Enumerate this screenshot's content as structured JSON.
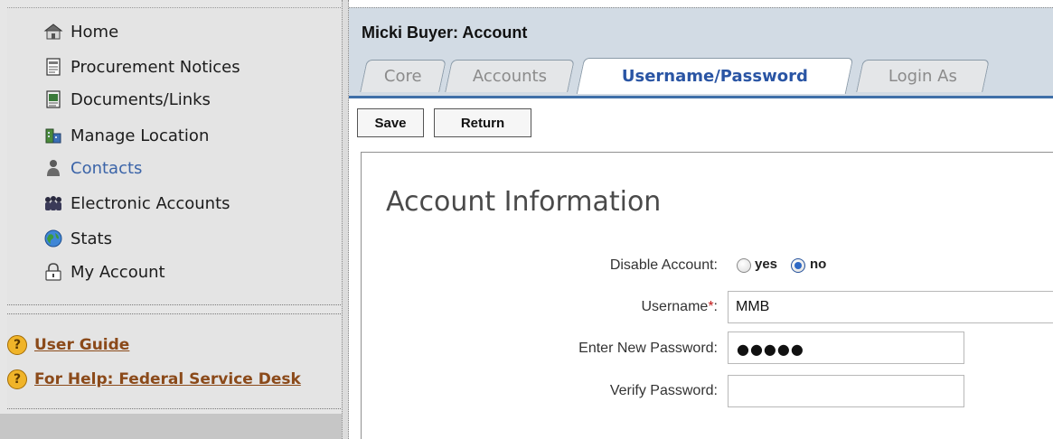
{
  "sidebar": {
    "nav": [
      {
        "label": "Home",
        "icon": "home-icon"
      },
      {
        "label": "Procurement Notices",
        "icon": "notice-document-icon"
      },
      {
        "label": "Documents/Links",
        "icon": "document-link-icon"
      },
      {
        "label": "Manage Location",
        "icon": "building-icon"
      },
      {
        "label": "Contacts",
        "icon": "person-icon"
      },
      {
        "label": "Electronic Accounts",
        "icon": "group-icon"
      },
      {
        "label": "Stats",
        "icon": "globe-icon"
      },
      {
        "label": "My Account",
        "icon": "lock-icon"
      }
    ],
    "help": [
      {
        "label": "User Guide",
        "icon": "help-icon"
      },
      {
        "label": "For Help: Federal Service Desk",
        "icon": "help-icon"
      }
    ],
    "help_icon_glyph": "?"
  },
  "header": {
    "title": "Micki Buyer: Account",
    "tabs": [
      {
        "label": "Core"
      },
      {
        "label": "Accounts"
      },
      {
        "label": "Username/Password"
      },
      {
        "label": "Login As"
      }
    ],
    "active_tab": "Username/Password"
  },
  "toolbar": {
    "save_label": "Save",
    "return_label": "Return"
  },
  "form": {
    "section_title": "Account Information",
    "disable_account": {
      "label": "Disable Account:",
      "options": [
        "yes",
        "no"
      ],
      "selected": "no"
    },
    "username": {
      "label": "Username",
      "required_mark": "*",
      "colon": ":",
      "value": "MMB"
    },
    "new_password": {
      "label": "Enter New Password:",
      "masked_value": "●●●●●"
    },
    "verify_password": {
      "label": "Verify Password:",
      "value": ""
    }
  },
  "colors": {
    "sidebar_bg": "#e6e6e6",
    "header_bg": "#d2dbe4",
    "active_tab_text": "#2a55a4",
    "link_brown": "#8b4a1a",
    "required": "#c01818",
    "contacts_active": "#3b64a8"
  }
}
